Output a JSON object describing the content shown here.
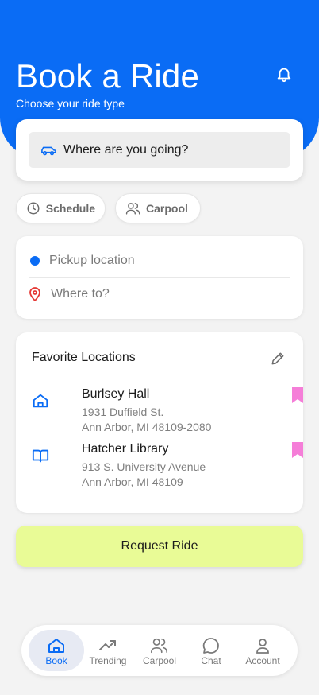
{
  "header": {
    "title": "Book a Ride",
    "subtitle": "Choose your ride type",
    "bell_icon": "bell-icon"
  },
  "search": {
    "placeholder": "Where are you going?",
    "icon": "car-icon"
  },
  "chips": [
    {
      "label": "Schedule",
      "icon": "clock-icon"
    },
    {
      "label": "Carpool",
      "icon": "people-icon"
    }
  ],
  "locations": {
    "pickup": "Pickup location",
    "destination": "Where to?"
  },
  "favorites": {
    "title": "Favorite Locations",
    "items": [
      {
        "name": "Burlsey Hall",
        "line1": "1931 Duffield St.",
        "line2": "Ann Arbor, MI 48109-2080",
        "icon": "home-icon"
      },
      {
        "name": "Hatcher Library",
        "line1": "913 S. University Avenue",
        "line2": "Ann Arbor, MI 48109",
        "icon": "book-icon"
      }
    ]
  },
  "request_label": "Request Ride",
  "tabs": [
    {
      "label": "Book",
      "icon": "home-icon",
      "active": true
    },
    {
      "label": "Trending",
      "icon": "trending-icon"
    },
    {
      "label": "Carpool",
      "icon": "people-icon"
    },
    {
      "label": "Chat",
      "icon": "chat-icon"
    },
    {
      "label": "Account",
      "icon": "account-icon"
    }
  ],
  "colors": {
    "primary": "#0a6cf5",
    "accent_button": "#e9fb96",
    "bookmark": "#f57ed8",
    "pin": "#e53935"
  }
}
